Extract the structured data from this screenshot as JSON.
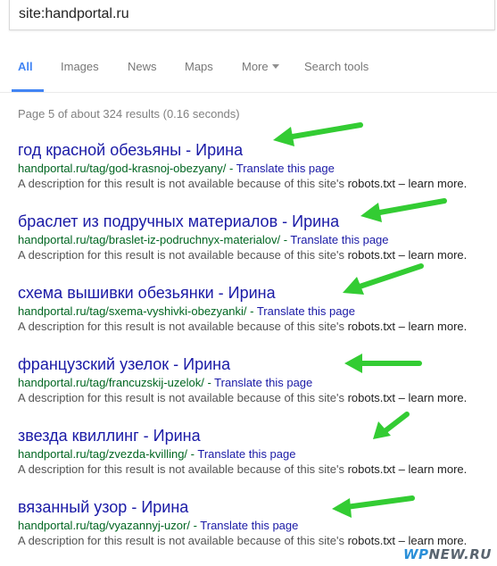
{
  "search": {
    "query": "site:handportal.ru"
  },
  "tabs": [
    {
      "label": "All",
      "active": true
    },
    {
      "label": "Images"
    },
    {
      "label": "News"
    },
    {
      "label": "Maps"
    },
    {
      "label": "More"
    },
    {
      "label": "Search tools"
    }
  ],
  "stats": "Page 5 of about 324 results (0.16 seconds)",
  "results": [
    {
      "title": "год красной обезьяны - Ирина",
      "url": "handportal.ru/tag/god-krasnoj-obezyany/",
      "translate": "Translate this page",
      "desc_start": "A description for this result is not available because of this site's",
      "desc_link": "robots.txt",
      "desc_end": "– learn more."
    },
    {
      "title": "браслет из подручных материалов - Ирина",
      "url": "handportal.ru/tag/braslet-iz-podruchnyx-materialov/",
      "translate": "Translate this page",
      "desc_start": "A description for this result is not available because of this site's",
      "desc_link": "robots.txt",
      "desc_end": "– learn more."
    },
    {
      "title": "схема вышивки обезьянки - Ирина",
      "url": "handportal.ru/tag/sxema-vyshivki-obezyanki/",
      "translate": "Translate this page",
      "desc_start": "A description for this result is not available because of this site's",
      "desc_link": "robots.txt",
      "desc_end": "– learn more."
    },
    {
      "title": "французский узелок - Ирина",
      "url": "handportal.ru/tag/francuzskij-uzelok/",
      "translate": "Translate this page",
      "desc_start": "A description for this result is not available because of this site's",
      "desc_link": "robots.txt",
      "desc_end": "– learn more."
    },
    {
      "title": "звезда квиллинг - Ирина",
      "url": "handportal.ru/tag/zvezda-kvilling/",
      "translate": "Translate this page",
      "desc_start": "A description for this result is not available because of this site's",
      "desc_link": "robots.txt",
      "desc_end": "– learn more."
    },
    {
      "title": "вязанный узор - Ирина",
      "url": "handportal.ru/tag/vyazannyj-uzor/",
      "translate": "Translate this page",
      "desc_start": "A description for this result is not available because of this site's",
      "desc_link": "robots.txt",
      "desc_end": "– learn more."
    }
  ],
  "watermark": {
    "part1": "WP",
    "part2": "NEW.RU"
  },
  "colors": {
    "accent": "#4285f4",
    "title": "#1a1aa6",
    "url": "#006621",
    "arrow": "#33cc33"
  }
}
